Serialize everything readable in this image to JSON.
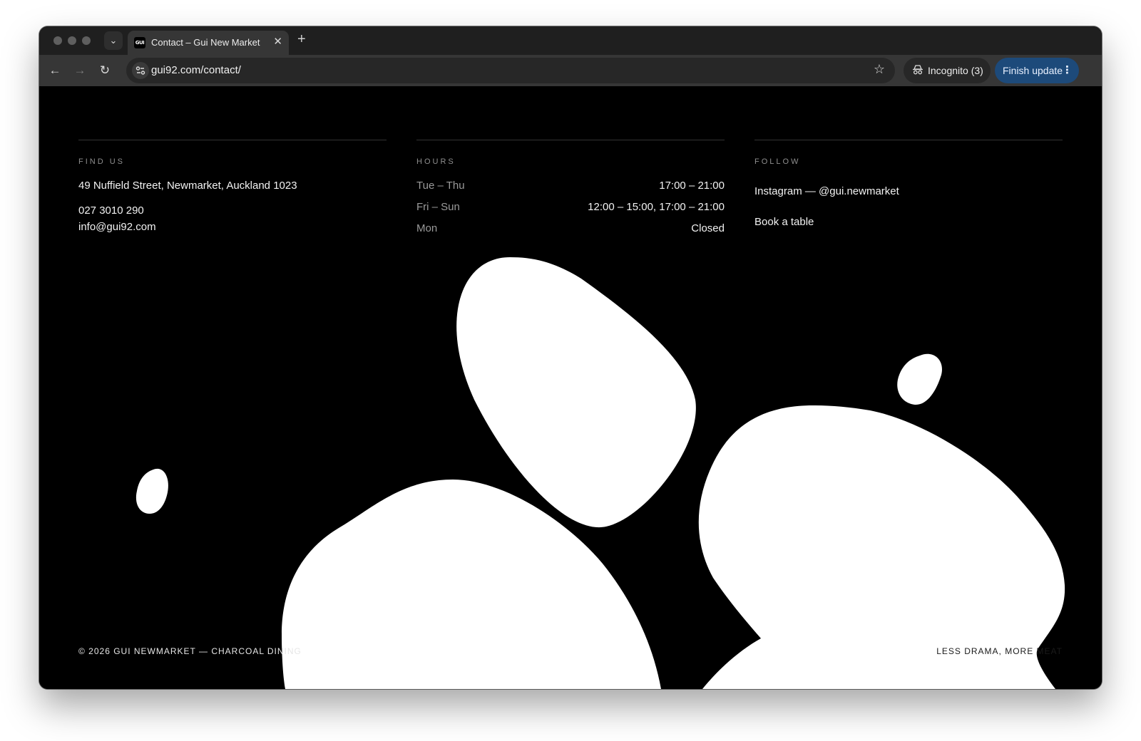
{
  "browser": {
    "tab_title": "Contact – Gui New Market",
    "favicon_text": "GUI",
    "url": "gui92.com/contact/",
    "incognito_label": "Incognito (3)",
    "update_label": "Finish update",
    "update_color": "#1d4a7a"
  },
  "contact": {
    "find_us": {
      "heading": "FIND US",
      "address": "49 Nuffield Street, Newmarket, Auckland 1023",
      "phone": "027 3010 290",
      "email": "info@gui92.com"
    },
    "hours": {
      "heading": "HOURS",
      "rows": [
        {
          "days": "Tue – Thu",
          "times": "17:00 – 21:00"
        },
        {
          "days": "Fri – Sun",
          "times": "12:00 – 15:00, 17:00 – 21:00"
        },
        {
          "days": "Mon",
          "times": "Closed"
        }
      ]
    },
    "follow": {
      "heading": "FOLLOW",
      "instagram": "Instagram — @gui.newmarket",
      "book": "Book a table"
    }
  },
  "footer": {
    "copyright": "© 2026 GUI NEWMARKET — CHARCOAL DINING",
    "tagline": "LESS DRAMA, MORE MEAT"
  },
  "colors": {
    "page_background": "#000000",
    "blob": "#ffffff"
  }
}
